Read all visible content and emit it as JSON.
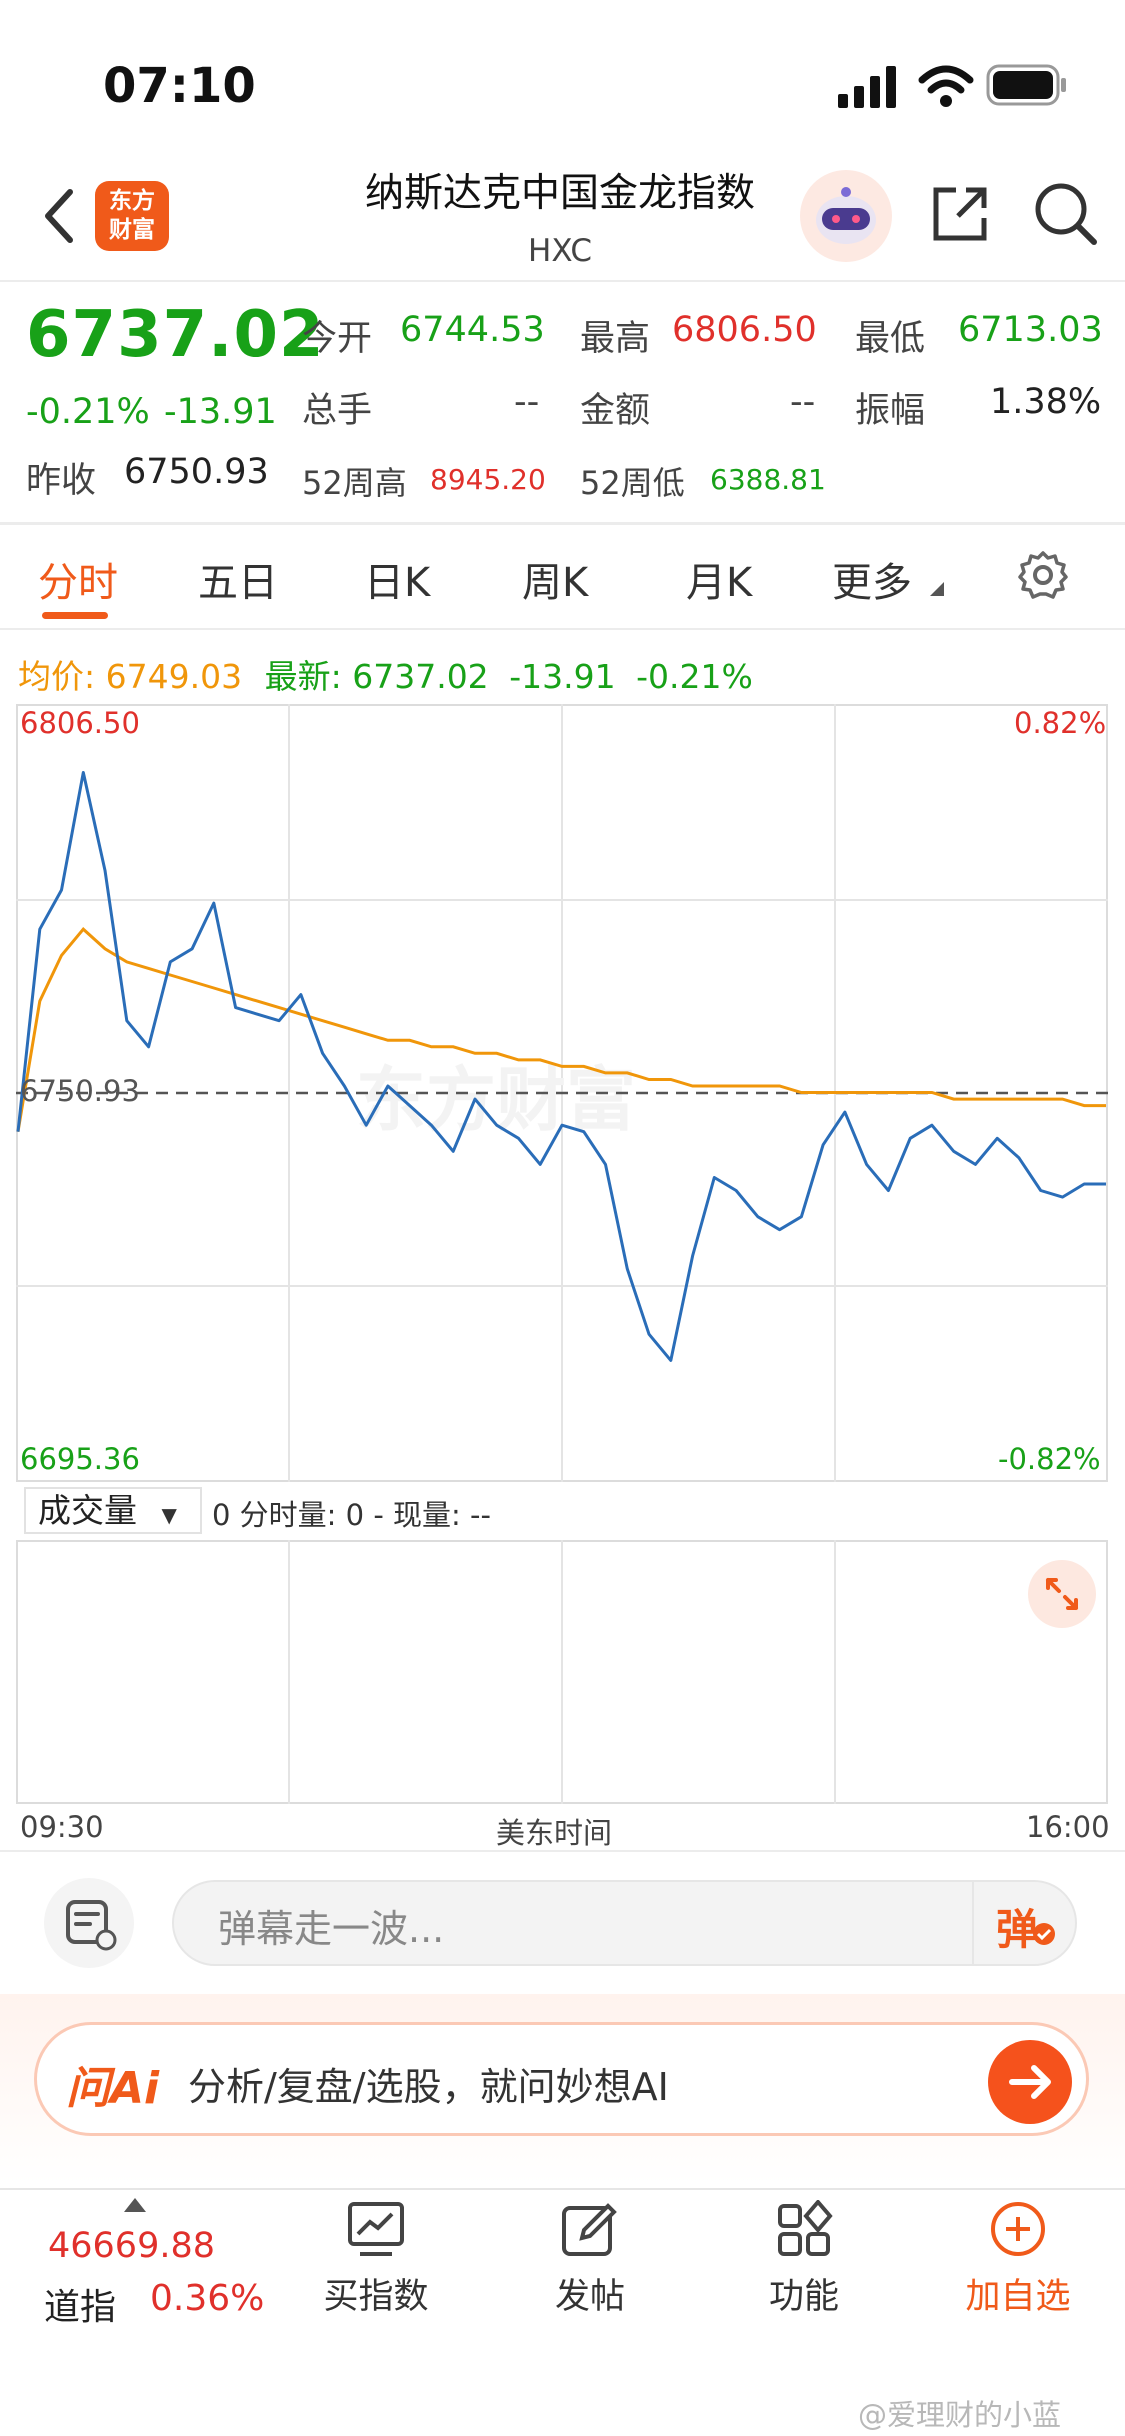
{
  "status": {
    "time": "07:10"
  },
  "header": {
    "title": "纳斯达克中国金龙指数",
    "subtitle": "HXC",
    "logo_text_1": "东方",
    "logo_text_2": "财富"
  },
  "quote": {
    "price": "6737.02",
    "change_pct": "-0.21%",
    "change_abs": "-13.91",
    "prev_close_label": "昨收",
    "prev_close": "6750.93",
    "open_label": "今开",
    "open": "6744.53",
    "high_label": "最高",
    "high": "6806.50",
    "low_label": "最低",
    "low": "6713.03",
    "volume_label": "总手",
    "volume": "--",
    "amount_label": "金额",
    "amount": "--",
    "amplitude_label": "振幅",
    "amplitude": "1.38%",
    "wk52_high_label": "52周高",
    "wk52_high": "8945.20",
    "wk52_low_label": "52周低",
    "wk52_low": "6388.81"
  },
  "tabs": [
    "分时",
    "五日",
    "日K",
    "周K",
    "月K",
    "更多"
  ],
  "legend": {
    "avg_label": "均价:",
    "avg": "6749.03",
    "latest_label": "最新:",
    "latest": "6737.02",
    "latest_chg": "-13.91",
    "latest_pct": "-0.21%"
  },
  "chart_data": {
    "type": "line",
    "ylim": [
      6695.36,
      6806.5
    ],
    "y_tick_labels": {
      "top": "6806.50",
      "bottom": "6695.36",
      "ref": "6750.93",
      "top_pct": "0.82%",
      "bottom_pct": "-0.82%"
    },
    "reference_line": 6750.93,
    "x_labels": {
      "start": "09:30",
      "mid": "美东时间",
      "end": "16:00"
    },
    "x": [
      0,
      2,
      4,
      6,
      8,
      10,
      12,
      14,
      16,
      18,
      20,
      22,
      24,
      26,
      28,
      30,
      32,
      34,
      36,
      38,
      40,
      42,
      44,
      46,
      48,
      50,
      52,
      54,
      56,
      58,
      60,
      62,
      64,
      66,
      68,
      70,
      72,
      74,
      76,
      78,
      80,
      82,
      84,
      86,
      88,
      90,
      92,
      94,
      96,
      98,
      100
    ],
    "series": [
      {
        "name": "最新",
        "color": "#2a6db8",
        "values": [
          6745,
          6776,
          6782,
          6800,
          6785,
          6762,
          6758,
          6771,
          6773,
          6780,
          6764,
          6763,
          6762,
          6766,
          6757,
          6752,
          6746,
          6752,
          6749,
          6746,
          6742,
          6750,
          6746,
          6744,
          6740,
          6746,
          6745,
          6740,
          6724,
          6714,
          6710,
          6726,
          6738,
          6736,
          6732,
          6730,
          6732,
          6743,
          6748,
          6740,
          6736,
          6744,
          6746,
          6742,
          6740,
          6744,
          6741,
          6736,
          6735,
          6737,
          6737
        ]
      },
      {
        "name": "均价",
        "color": "#f0960a",
        "values": [
          6745,
          6765,
          6772,
          6776,
          6773,
          6771,
          6770,
          6769,
          6768,
          6767,
          6766,
          6765,
          6764,
          6763,
          6762,
          6761,
          6760,
          6759,
          6759,
          6758,
          6758,
          6757,
          6757,
          6756,
          6756,
          6755,
          6755,
          6754,
          6754,
          6753,
          6753,
          6752,
          6752,
          6752,
          6752,
          6752,
          6751,
          6751,
          6751,
          6751,
          6751,
          6751,
          6751,
          6750,
          6750,
          6750,
          6750,
          6750,
          6750,
          6749,
          6749
        ]
      }
    ]
  },
  "volume": {
    "select_label": "成交量",
    "info": "0 分时量: 0 - 现量: --"
  },
  "comment": {
    "placeholder": "弹幕走一波...",
    "danmu_label": "弹"
  },
  "ai": {
    "logo": "问Ai",
    "text": "分析/复盘/选股，就问妙想AI"
  },
  "bottom_nav": {
    "dji_value": "46669.88",
    "dji_name": "道指",
    "dji_pct": "0.36%",
    "items": [
      "买指数",
      "发帖",
      "功能",
      "加自选"
    ]
  },
  "watermark": "@爱理财的小蓝",
  "colors": {
    "accent": "#f05a1a",
    "up": "#e0302b",
    "down": "#18a118",
    "price_line": "#2a6db8",
    "avg_line": "#f0960a"
  }
}
